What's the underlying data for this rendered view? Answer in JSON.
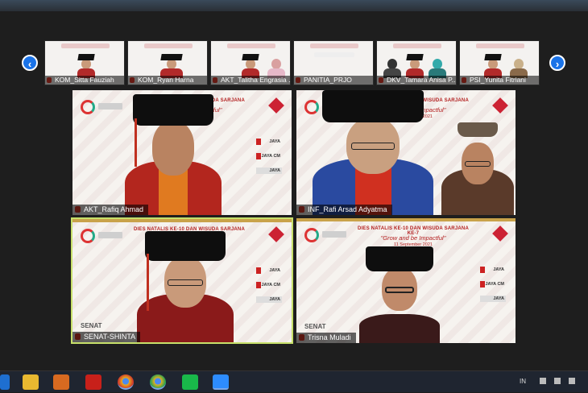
{
  "thumbnails": [
    {
      "name": "KOM_Sitta Fauziah"
    },
    {
      "name": "KOM_Ryan Harna"
    },
    {
      "name": "AKT_Talitha Engrasia ..."
    },
    {
      "name": "PANITIA_PRJO"
    },
    {
      "name": "DKV_Tamara Anisa P..."
    },
    {
      "name": "PSI_Yunita Fitriani"
    }
  ],
  "tiles": [
    {
      "name": "AKT_Rafiq Ahmad",
      "event": "DIES NATALIS KE-10 DAN WISUDA SARJANA KE-7",
      "tagline": "\"Grow and be Impactful\"",
      "date": "11 September 2021"
    },
    {
      "name": "INF_Rafi Arsad Adyatma",
      "event": "DIES NATALIS KE-10 DAN WISUDA SARJANA KE-7",
      "tagline": "\"Grow and be Impactful\"",
      "date": "11 September 2021"
    },
    {
      "name": "SENAT-SHINTA",
      "label": "SENAT",
      "event": "DIES NATALIS KE-10 DAN WISUDA SARJANA KE-7",
      "tagline": "\"Grow and be Impactful\"",
      "date": "11 September 2021"
    },
    {
      "name": "Trisna Muladi",
      "label": "SENAT",
      "event": "DIES NATALIS KE-10 DAN WISUDA SARJANA KE-7",
      "tagline": "\"Grow and be Impactful\"",
      "date": "11 September 2021"
    }
  ],
  "sponsors": [
    "JAYA",
    "JAYA CM",
    "JAYA"
  ],
  "nav": {
    "prev": "‹",
    "next": "›"
  },
  "tray": {
    "lang": "IN"
  },
  "colors": {
    "accent": "#1a73e8",
    "active_border": "#c7e06a",
    "robe": "#b3261e"
  },
  "taskbar_icons": [
    "ie-icon",
    "folder-icon",
    "media-player-icon",
    "pdf-icon",
    "chrome-icon",
    "chrome-icon",
    "line-icon",
    "zoom-icon"
  ]
}
